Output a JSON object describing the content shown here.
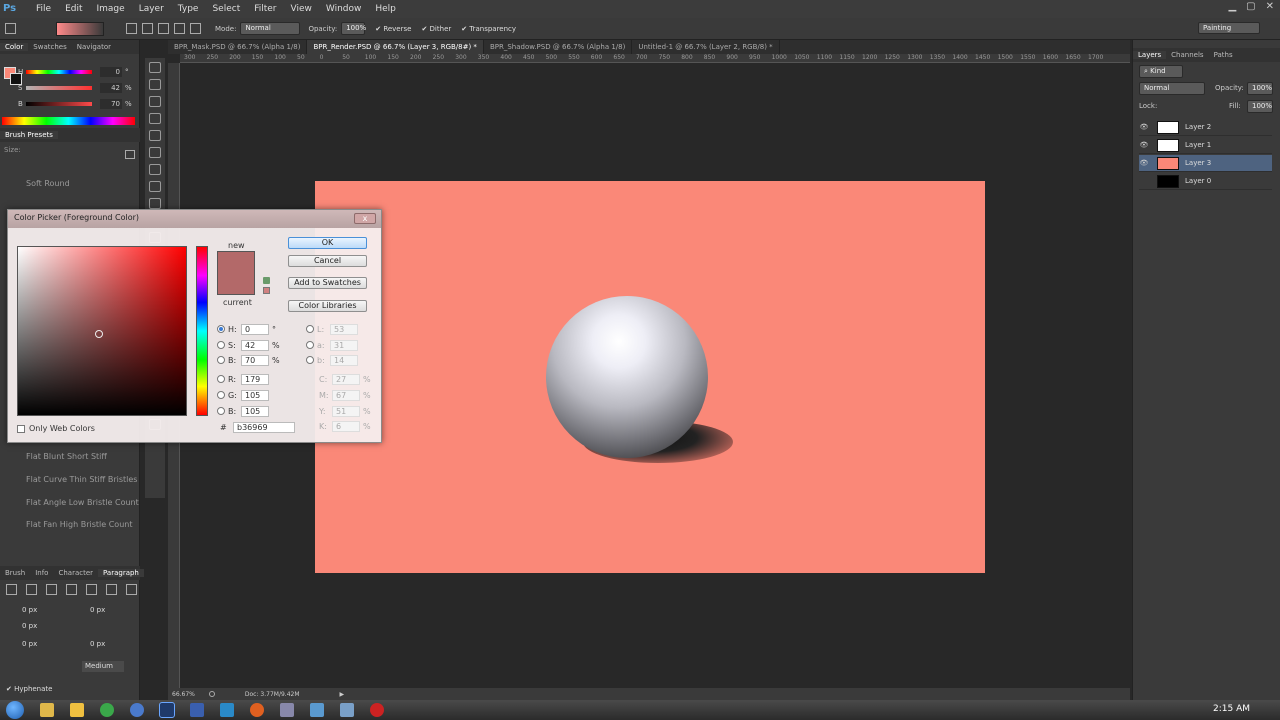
{
  "app": {
    "logo": "Ps",
    "menu": [
      "File",
      "Edit",
      "Image",
      "Layer",
      "Type",
      "Select",
      "Filter",
      "View",
      "Window",
      "Help"
    ]
  },
  "options_bar": {
    "mode_label": "Mode:",
    "mode_value": "Normal",
    "opacity_label": "Opacity:",
    "opacity_value": "100%",
    "reverse": "Reverse",
    "dither": "Dither",
    "transparency": "Transparency",
    "workspace": "Painting"
  },
  "left_panel": {
    "tabs": [
      "Color",
      "Swatches",
      "Navigator"
    ],
    "hsb": [
      {
        "label": "H",
        "value": "0",
        "unit": "°"
      },
      {
        "label": "S",
        "value": "42",
        "unit": "%"
      },
      {
        "label": "B",
        "value": "70",
        "unit": "%"
      }
    ],
    "brush_presets_title": "Brush Presets",
    "size_label": "Size:",
    "brushes": [
      "Soft Round",
      "Flat Blunt Short Stiff",
      "Flat Curve Thin Stiff Bristles",
      "Flat Angle Low Bristle Count",
      "Flat Fan High Bristle Count"
    ],
    "para_tabs": [
      "Brush",
      "Info",
      "Character",
      "Paragraph"
    ],
    "para_values": [
      "0 px",
      "0 px",
      "0 px",
      "0 px",
      "0 px"
    ],
    "medium": "Medium",
    "hyphenate": "Hyphenate"
  },
  "doc_tabs": [
    "BPR_Mask.PSD @ 66.7% (Alpha 1/8)",
    "BPR_Render.PSD @ 66.7% (Layer 3, RGB/8#) *",
    "BPR_Shadow.PSD @ 66.7% (Alpha 1/8)",
    "Untitled-1 @ 66.7% (Layer 2, RGB/8) *"
  ],
  "ruler_ticks": [
    "300",
    "250",
    "200",
    "150",
    "100",
    "50",
    "0",
    "50",
    "100",
    "150",
    "200",
    "250",
    "300",
    "350",
    "400",
    "450",
    "500",
    "550",
    "600",
    "650",
    "700",
    "750",
    "800",
    "850",
    "900",
    "950",
    "1000",
    "1050",
    "1100",
    "1150",
    "1200",
    "1250",
    "1300",
    "1350",
    "1400",
    "1450",
    "1500",
    "1550",
    "1600",
    "1650",
    "1700"
  ],
  "status": {
    "zoom": "66.67%",
    "doc": "Doc: 3.77M/9.42M"
  },
  "layers_panel": {
    "tabs": [
      "Layers",
      "Channels",
      "Paths"
    ],
    "kind": "Kind",
    "blend": "Normal",
    "opacity_label": "Opacity:",
    "opacity": "100%",
    "lock_label": "Lock:",
    "fill_label": "Fill:",
    "fill": "100%",
    "layers": [
      {
        "name": "Layer 2",
        "thumb": "#ffffff",
        "visible": "👁"
      },
      {
        "name": "Layer 1",
        "thumb": "#ffffff",
        "visible": "👁"
      },
      {
        "name": "Layer 3",
        "thumb": "#fa8878",
        "visible": "👁"
      },
      {
        "name": "Layer 0",
        "thumb": "#000000",
        "visible": ""
      }
    ]
  },
  "color_picker": {
    "title": "Color Picker (Foreground Color)",
    "close": "x",
    "new_label": "new",
    "current_label": "current",
    "color": "#b36969",
    "buttons": {
      "ok": "OK",
      "cancel": "Cancel",
      "add": "Add to Swatches",
      "libraries": "Color Libraries"
    },
    "fields_left": [
      {
        "label": "H:",
        "value": "0",
        "unit": "°"
      },
      {
        "label": "S:",
        "value": "42",
        "unit": "%"
      },
      {
        "label": "B:",
        "value": "70",
        "unit": "%"
      },
      {
        "label": "R:",
        "value": "179",
        "unit": ""
      },
      {
        "label": "G:",
        "value": "105",
        "unit": ""
      },
      {
        "label": "B:",
        "value": "105",
        "unit": ""
      }
    ],
    "fields_right": [
      {
        "label": "L:",
        "value": "53",
        "unit": ""
      },
      {
        "label": "a:",
        "value": "31",
        "unit": ""
      },
      {
        "label": "b:",
        "value": "14",
        "unit": ""
      },
      {
        "label": "C:",
        "value": "27",
        "unit": "%"
      },
      {
        "label": "M:",
        "value": "67",
        "unit": "%"
      },
      {
        "label": "Y:",
        "value": "51",
        "unit": "%"
      },
      {
        "label": "K:",
        "value": "6",
        "unit": "%"
      }
    ],
    "hex_label": "#",
    "hex": "b36969",
    "web_colors": "Only Web Colors"
  },
  "taskbar": {
    "clock": "2:15 AM"
  }
}
